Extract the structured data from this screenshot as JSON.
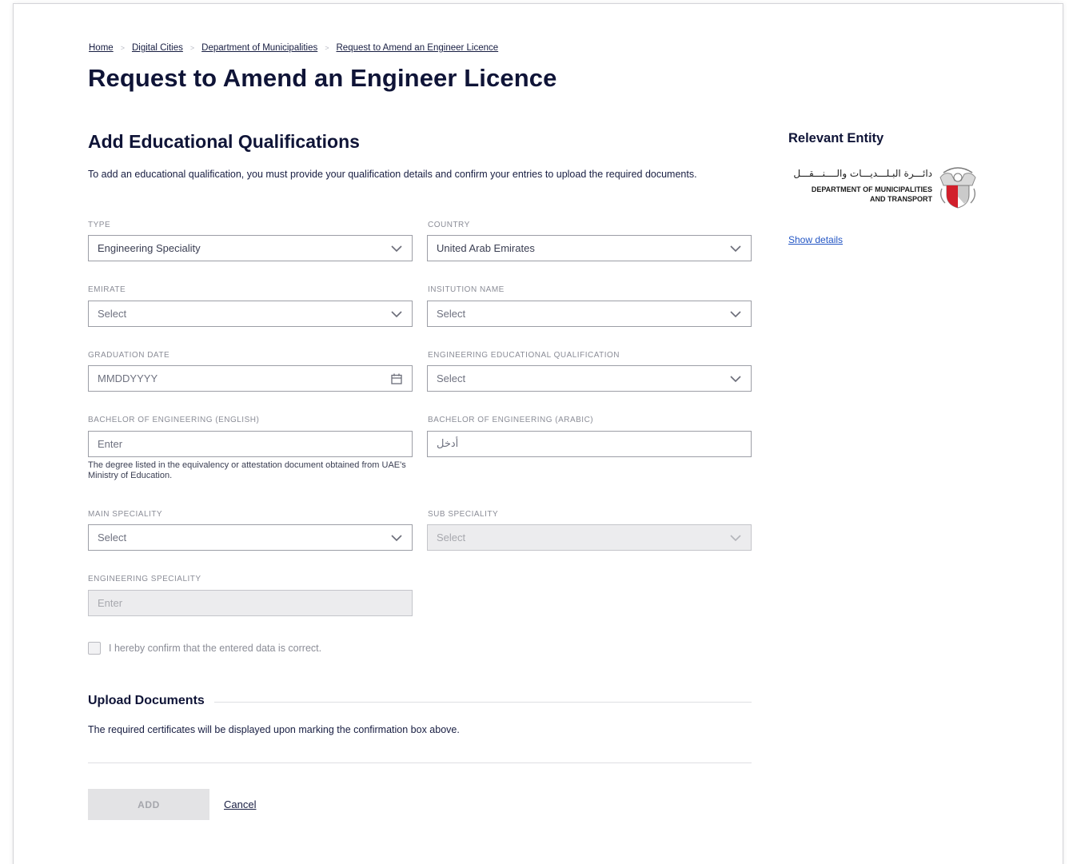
{
  "breadcrumb": [
    "Home",
    "Digital Cities",
    "Department of Municipalities",
    "Request to Amend an Engineer Licence"
  ],
  "page_title": "Request to Amend an Engineer Licence",
  "section": {
    "title": "Add Educational Qualifications",
    "intro": "To add an educational qualification, you must provide your qualification details and confirm your entries to upload the required documents."
  },
  "fields": {
    "type": {
      "label": "TYPE",
      "value": "Engineering Speciality"
    },
    "country": {
      "label": "COUNTRY",
      "value": "United Arab Emirates"
    },
    "emirate": {
      "label": "EMIRATE",
      "placeholder": "Select"
    },
    "institution": {
      "label": "INSITUTION NAME",
      "placeholder": "Select"
    },
    "graduation_date": {
      "label": "GRADUATION DATE",
      "placeholder": "MMDDYYYY"
    },
    "eng_qualification": {
      "label": "ENGINEERING EDUCATIONAL QUALIFICATION",
      "placeholder": "Select"
    },
    "bachelor_en": {
      "label": "BACHELOR OF ENGINEERING (ENGLISH)",
      "placeholder": "Enter",
      "hint": "The degree listed in the equivalency or attestation document obtained from UAE's Ministry of Education."
    },
    "bachelor_ar": {
      "label": "BACHELOR OF ENGINEERING (ARABIC)",
      "placeholder": "أدخل"
    },
    "main_speciality": {
      "label": "MAIN SPECIALITY",
      "placeholder": "Select"
    },
    "sub_speciality": {
      "label": "SUB SPECIALITY",
      "placeholder": "Select"
    },
    "engineering_speciality": {
      "label": "ENGINEERING SPECIALITY",
      "placeholder": "Enter"
    }
  },
  "confirm_text": "I hereby confirm that the entered data is correct.",
  "upload": {
    "title": "Upload Documents",
    "text": "The required certificates will be displayed upon marking the confirmation box above."
  },
  "actions": {
    "add_label": "ADD",
    "cancel_label": "Cancel"
  },
  "aside": {
    "title": "Relevant Entity",
    "entity_ar": "دائـــرة البـلـــديـــات والــــنـــقـــل",
    "entity_en_line1": "DEPARTMENT OF MUNICIPALITIES",
    "entity_en_line2": "AND TRANSPORT",
    "show_details": "Show details"
  },
  "icons": {
    "dropdown": "chevron-down-icon",
    "date": "calendar-icon",
    "emblem": "abu-dhabi-emblem-icon"
  },
  "colors": {
    "text": "#0f1437",
    "link": "#2255c4",
    "disabled_bg": "#ececee"
  }
}
